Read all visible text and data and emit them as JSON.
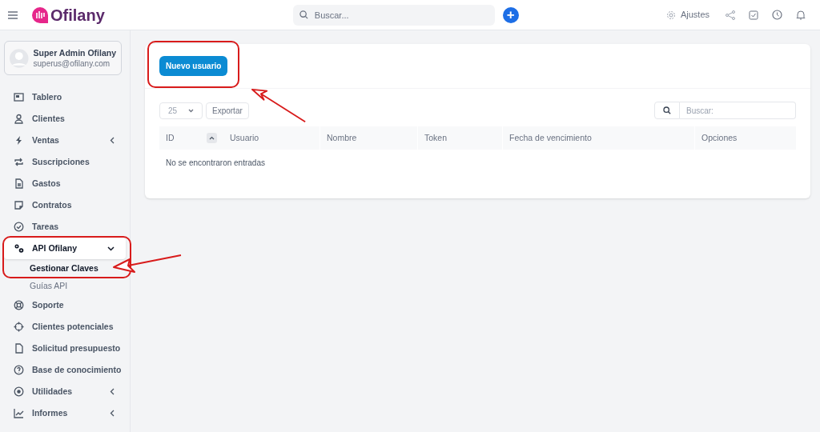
{
  "header": {
    "logo": "Ofilany",
    "search": {
      "placeholder": "Buscar..."
    },
    "add_button": "+",
    "settings": "Ajustes"
  },
  "profile": {
    "name": "Super Admin Ofilany",
    "email": "superus@ofilany.com"
  },
  "sidebar": {
    "items": [
      {
        "label": "Tablero",
        "selected": false
      },
      {
        "label": "Clientes",
        "selected": false
      },
      {
        "label": "Ventas",
        "selected": false,
        "expanded": false
      },
      {
        "label": "Suscripciones",
        "selected": false
      },
      {
        "label": "Gastos",
        "selected": false
      },
      {
        "label": "Contratos",
        "selected": false
      },
      {
        "label": "Tareas",
        "selected": false
      },
      {
        "label": "API Ofilany",
        "selected": true,
        "expanded": true,
        "children": [
          {
            "label": "Gestionar Claves",
            "selected": true
          },
          {
            "label": "Guías API",
            "selected": false
          }
        ]
      },
      {
        "label": "Soporte",
        "selected": false
      },
      {
        "label": "Clientes potenciales",
        "selected": false
      },
      {
        "label": "Solicitud presupuesto",
        "selected": false
      },
      {
        "label": "Base de conocimiento",
        "selected": false
      },
      {
        "label": "Utilidades",
        "selected": false,
        "expanded": false
      },
      {
        "label": "Informes",
        "selected": false,
        "expanded": false
      }
    ]
  },
  "content": {
    "new_button": "Nuevo usuario",
    "page_size": "25",
    "export_button": "Exportar",
    "search": {
      "placeholder": "Buscar:"
    },
    "table": {
      "columns": [
        "ID",
        "Usuario",
        "Nombre",
        "Token",
        "Fecha de vencimiento",
        "Opciones"
      ],
      "empty_message": "No se encontraron entradas"
    }
  }
}
